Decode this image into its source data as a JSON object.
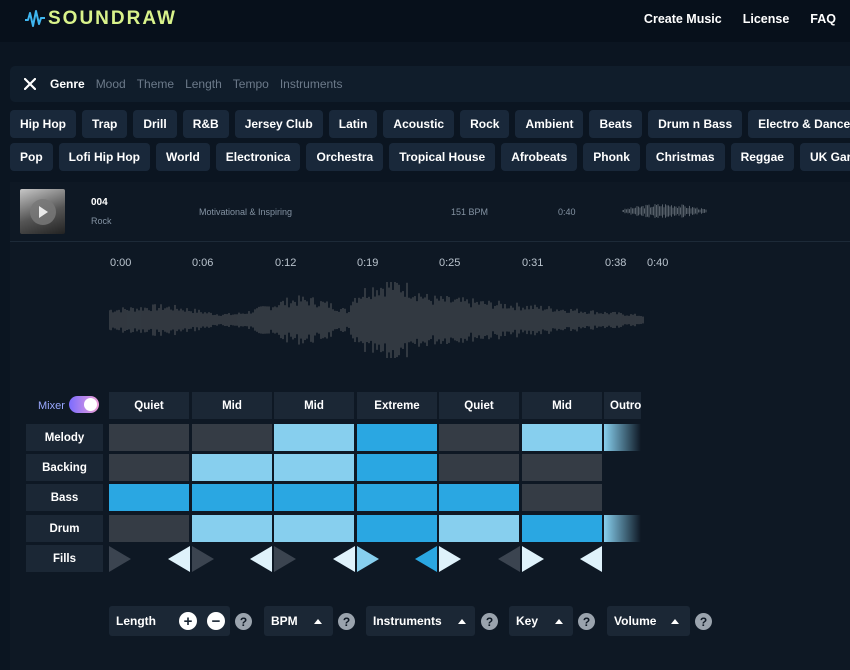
{
  "header": {
    "logo_text": "SOUNDRAW",
    "logo_icon": "waveform-logo-icon",
    "nav": [
      "Create Music",
      "License",
      "FAQ"
    ]
  },
  "filters": {
    "close_icon": "close-icon",
    "tabs": [
      "Genre",
      "Mood",
      "Theme",
      "Length",
      "Tempo",
      "Instruments"
    ],
    "active_tab": "Genre"
  },
  "genres": {
    "row1": [
      "Hip Hop",
      "Trap",
      "Drill",
      "R&B",
      "Jersey Club",
      "Latin",
      "Acoustic",
      "Rock",
      "Ambient",
      "Beats",
      "Drum n Bass",
      "Electro & Dance"
    ],
    "row2": [
      "Pop",
      "Lofi Hip Hop",
      "World",
      "Electronica",
      "Orchestra",
      "Tropical House",
      "Afrobeats",
      "Phonk",
      "Christmas",
      "Reggae",
      "UK Garage"
    ]
  },
  "track": {
    "title": "004",
    "genre": "Rock",
    "mood": "Motivational & Inspiring",
    "bpm": "151 BPM",
    "duration": "0:40",
    "play_icon": "play-icon"
  },
  "timeline": [
    "0:00",
    "0:06",
    "0:12",
    "0:19",
    "0:25",
    "0:31",
    "0:38",
    "0:40"
  ],
  "mixer": {
    "label": "Mixer",
    "toggle_on": true,
    "sections": [
      "Quiet",
      "Mid",
      "Mid",
      "Extreme",
      "Quiet",
      "Mid",
      "Outro"
    ],
    "instruments": [
      "Melody",
      "Backing",
      "Bass",
      "Drum",
      "Fills"
    ],
    "levels": {
      "Melody": [
        "low",
        "low",
        "high",
        "max",
        "low",
        "high",
        "fade"
      ],
      "Backing": [
        "low",
        "high",
        "high",
        "max",
        "low",
        "low",
        "none"
      ],
      "Bass": [
        "max",
        "max",
        "max",
        "max",
        "max",
        "low",
        "none"
      ],
      "Drum": [
        "low",
        "high",
        "high",
        "max",
        "high",
        "max",
        "fade"
      ]
    }
  },
  "controls": {
    "length": "Length",
    "bpm": "BPM",
    "instruments": "Instruments",
    "key": "Key",
    "volume": "Volume",
    "help": "?",
    "plus": "+",
    "minus": "−"
  },
  "colors": {
    "logo": "#d9f38b",
    "cell_low": "#353c45",
    "cell_high": "#87cfee",
    "cell_max": "#2aa7e2"
  }
}
